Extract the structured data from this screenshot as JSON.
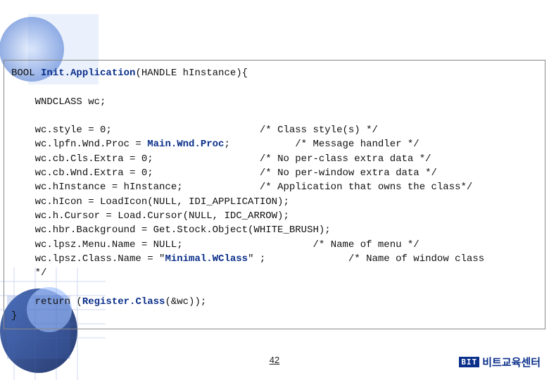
{
  "code": {
    "decl": {
      "ret": "BOOL ",
      "fn": "Init.Application",
      "sig": "(HANDLE hInstance){"
    },
    "var": "    WNDCLASS wc;",
    "lines": [
      {
        "l": "    wc.style = 0;                         ",
        "c": "/* Class style(s) */"
      },
      {
        "l": "    wc.lpfn.Wnd.Proc = ",
        "hl": "Main.Wnd.Proc",
        "l2": ";           ",
        "c": "/* Message handler */"
      },
      {
        "l": "    wc.cb.Cls.Extra = 0;                  ",
        "c": "/* No per-class extra data */"
      },
      {
        "l": "    wc.cb.Wnd.Extra = 0;                  ",
        "c": "/* No per-window extra data */"
      },
      {
        "l": "    wc.hInstance = hInstance;             ",
        "c": "/* Application that owns the class*/"
      },
      {
        "l": "    wc.hIcon = LoadIcon(NULL, IDI_APPLICATION);"
      },
      {
        "l": "    wc.h.Cursor = Load.Cursor(NULL, IDC_ARROW);"
      },
      {
        "l": "    wc.hbr.Background = Get.Stock.Object(WHITE_BRUSH);"
      },
      {
        "l": "    wc.lpsz.Menu.Name = NULL;                      ",
        "c": "/* Name of menu */"
      },
      {
        "l": "    wc.lpsz.Class.Name = \"",
        "hl2": "Minimal.WClass",
        "l2b": "\" ;              ",
        "c2": "/* Name of window class"
      },
      {
        "l": "    */"
      }
    ],
    "ret_line": {
      "a": "    return (",
      "fn": "Register.Class",
      "b": "(&wc));"
    },
    "close": "}"
  },
  "page_num": "42",
  "brand": {
    "logo": "BIT",
    "text": "비트교육센터"
  }
}
